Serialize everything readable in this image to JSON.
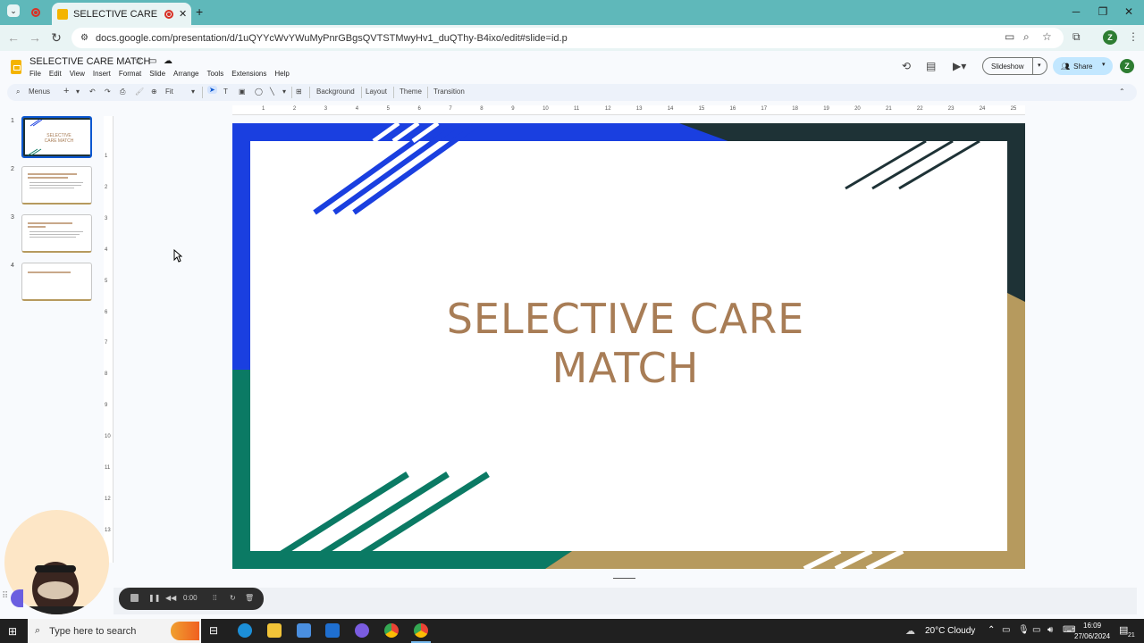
{
  "browser": {
    "tab_title": "SELECTIVE CARE MATCH - G",
    "url": "docs.google.com/presentation/d/1uQYYcWvYWuMyPnrGBgsQVTSTMwyHv1_duQThy-B4ixo/edit#slide=id.p",
    "profile_initial": "Z"
  },
  "doc": {
    "title": "SELECTIVE CARE MATCH",
    "menu": [
      "File",
      "Edit",
      "View",
      "Insert",
      "Format",
      "Slide",
      "Arrange",
      "Tools",
      "Extensions",
      "Help"
    ],
    "slideshow_label": "Slideshow",
    "share_label": "Share",
    "user_initial": "Z"
  },
  "toolbar": {
    "menus_label": "Menus",
    "zoom_label": "Fit",
    "background_label": "Background",
    "layout_label": "Layout",
    "theme_label": "Theme",
    "transition_label": "Transition"
  },
  "ruler": {
    "h_ticks": [
      "1",
      "2",
      "3",
      "4",
      "5",
      "6",
      "7",
      "8",
      "9",
      "10",
      "11",
      "12",
      "13",
      "14",
      "15",
      "16",
      "17",
      "18",
      "19",
      "20",
      "21",
      "22",
      "23",
      "24",
      "25"
    ],
    "v_ticks": [
      "1",
      "2",
      "3",
      "4",
      "5",
      "6",
      "7",
      "8",
      "9",
      "10",
      "11",
      "12",
      "13"
    ]
  },
  "filmstrip": {
    "slides": [
      {
        "num": "1",
        "text": "SELECTIVE CARE MATCH"
      },
      {
        "num": "2",
        "text": ""
      },
      {
        "num": "3",
        "text": ""
      },
      {
        "num": "4",
        "text": ""
      }
    ]
  },
  "slide": {
    "title_line1": "SELECTIVE CARE",
    "title_line2": "MATCH",
    "colors": {
      "blue": "#1a3fe0",
      "dark": "#1e3236",
      "teal": "#0b7a64",
      "gold": "#b69a5e",
      "title": "#a87d56"
    }
  },
  "recorder": {
    "time": "0:00"
  },
  "taskbar": {
    "search_placeholder": "Type here to search",
    "weather": "20°C  Cloudy",
    "time": "16:09",
    "date": "27/06/2024",
    "notification_count": "21"
  }
}
